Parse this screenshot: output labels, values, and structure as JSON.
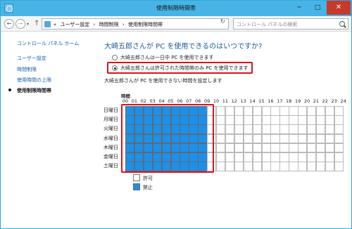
{
  "window": {
    "title": "使用制限時間帯"
  },
  "titlebar": {
    "minimize": "─",
    "maximize": "□",
    "close": "✕"
  },
  "nav": {
    "back": "←",
    "forward": "→",
    "dropdown": "▾",
    "up": "↑",
    "refresh": "↻"
  },
  "address": {
    "crumbs": [
      "«",
      "ユーザー設定",
      "›",
      "時間制限",
      "›",
      "使用制限時間帯"
    ],
    "dropdown": "▾"
  },
  "search": {
    "placeholder": "コントロール パネルの検索"
  },
  "sidebar": {
    "home": "コントロール パネル ホーム",
    "items": [
      {
        "label": "ユーザー設定",
        "active": false
      },
      {
        "label": "時間制限",
        "active": false
      },
      {
        "label": "使用時間の上限",
        "active": false
      },
      {
        "label": "使用制限時間帯",
        "active": true
      }
    ]
  },
  "main": {
    "heading": "大崎五郎さんが PC を使用できるのはいつですか?",
    "options": [
      {
        "label": "大崎五郎さんは一日中 PC を使用できます",
        "checked": false
      },
      {
        "label": "大崎五郎さんは許可された時間帯のみ PC を使用できます",
        "checked": true
      }
    ],
    "description": "大崎五郎さんが PC を使用できない時間を設定します"
  },
  "grid": {
    "label": "時間",
    "hours": [
      "00",
      "01",
      "02",
      "03",
      "04",
      "05",
      "06",
      "07",
      "08",
      "09",
      "10",
      "11",
      "12",
      "13",
      "14",
      "15",
      "16",
      "17",
      "18",
      "19",
      "20",
      "21",
      "22",
      "23",
      "24"
    ],
    "days": [
      "日曜日",
      "月曜日",
      "火曜日",
      "水曜日",
      "木曜日",
      "金曜日",
      "土曜日"
    ],
    "blocked_hours_per_day": 9
  },
  "legend": {
    "allow": "許可",
    "deny": "禁止"
  },
  "colors": {
    "deny": "#1e90e8",
    "highlight": "#d8141a",
    "titlebar": "#48b4e6"
  },
  "icons": {
    "app": "parental-controls-icon",
    "search": "search-icon"
  }
}
